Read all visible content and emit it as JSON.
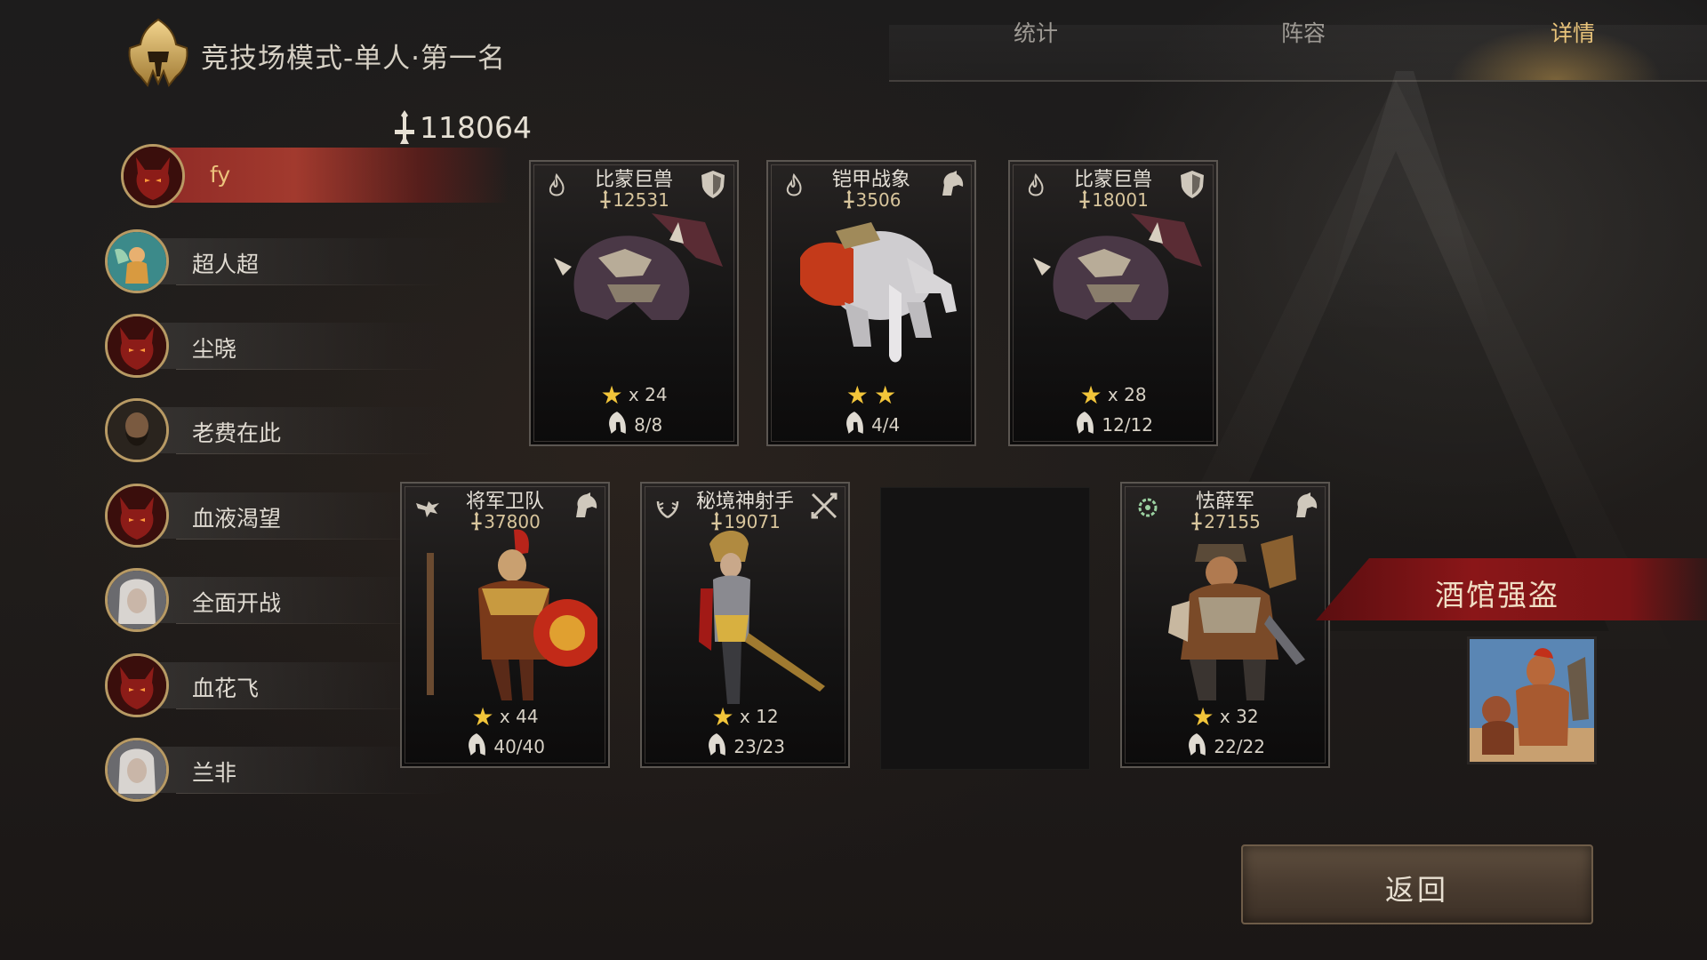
{
  "header": {
    "title": "竞技场模式-单人·第一名",
    "tabs": [
      {
        "label": "统计",
        "active": false
      },
      {
        "label": "阵容",
        "active": false
      },
      {
        "label": "详情",
        "active": true
      }
    ]
  },
  "power_total": "118064",
  "players": [
    {
      "name": "fy",
      "avatar": "demon-avatar",
      "selected": true
    },
    {
      "name": "超人超",
      "avatar": "angel-avatar",
      "selected": false
    },
    {
      "name": "尘晓",
      "avatar": "demon-avatar",
      "selected": false
    },
    {
      "name": "老费在此",
      "avatar": "bearded-man-avatar",
      "selected": false
    },
    {
      "name": "血液渴望",
      "avatar": "demon-avatar",
      "selected": false
    },
    {
      "name": "全面开战",
      "avatar": "elf-woman-avatar",
      "selected": false
    },
    {
      "name": "血花飞",
      "avatar": "demon-avatar",
      "selected": false
    },
    {
      "name": "兰非",
      "avatar": "elf-woman-avatar",
      "selected": false
    }
  ],
  "units": [
    {
      "name": "比蒙巨兽",
      "power": "12531",
      "stars": "x 24",
      "count": "8/8",
      "type_icon": "flame-icon",
      "class_icon": "shield-icon",
      "art": "behemoth"
    },
    {
      "name": "铠甲战象",
      "power": "3506",
      "stars": "",
      "star_count": 2,
      "count": "4/4",
      "type_icon": "flame-icon",
      "class_icon": "horse-head-icon",
      "art": "war-elephant"
    },
    {
      "name": "比蒙巨兽",
      "power": "18001",
      "stars": "x 28",
      "count": "12/12",
      "type_icon": "flame-icon",
      "class_icon": "shield-icon",
      "art": "behemoth"
    },
    {
      "name": "将军卫队",
      "power": "37800",
      "stars": "x 44",
      "count": "40/40",
      "type_icon": "eagle-icon",
      "class_icon": "horse-head-icon",
      "art": "roman-general"
    },
    {
      "name": "秘境神射手",
      "power": "19071",
      "stars": "x 12",
      "count": "23/23",
      "type_icon": "laurel-icon",
      "class_icon": "crossed-arrows-icon",
      "art": "archer"
    },
    {
      "name": "怯薛军",
      "power": "27155",
      "stars": "x 32",
      "count": "22/22",
      "type_icon": "wreath-icon",
      "class_icon": "horse-head-icon",
      "art": "mongol-warrior"
    }
  ],
  "hero": {
    "name": "酒馆强盗",
    "portrait": "bandit-portrait"
  },
  "back_button": {
    "label": "返回"
  },
  "colors": {
    "accent_gold": "#e8c37a",
    "selected_red": "#a23a2e",
    "banner_red": "#8a1618",
    "star": "#f2c53a"
  }
}
